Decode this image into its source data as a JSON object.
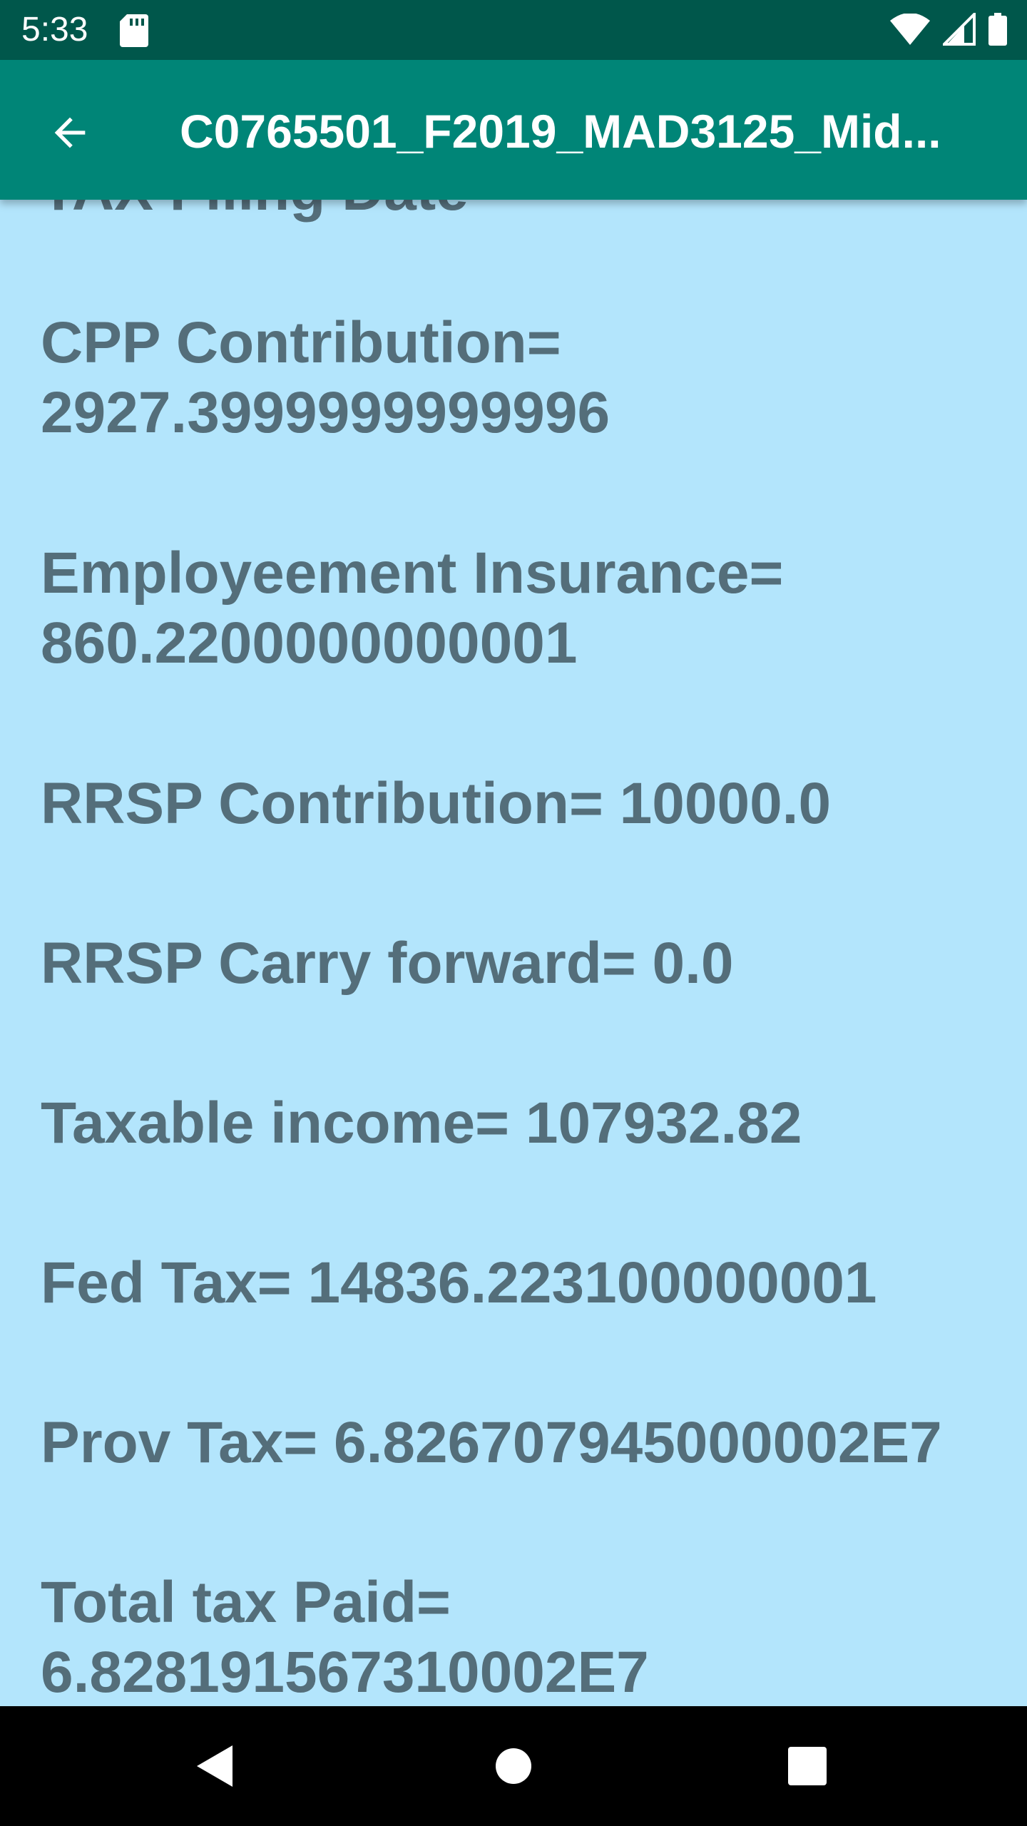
{
  "status_bar": {
    "time": "5:33",
    "icons": [
      "sd-card-icon",
      "wifi-icon",
      "signal-icon",
      "battery-icon"
    ]
  },
  "app_bar": {
    "title": "C0765501_F2019_MAD3125_Mid...",
    "back_icon": "arrow-back-icon"
  },
  "details": {
    "partial_label": "TAX Filing Date",
    "cpp_label": "CPP Contribution=",
    "cpp_value": "2927.3999999999996",
    "ei_label": "Employeement Insurance=",
    "ei_value": "860.2200000000001",
    "rrsp_label": "RRSP Contribution=",
    "rrsp_value": "10000.0",
    "rrsp_cf_label": "RRSP Carry forward=",
    "rrsp_cf_value": "0.0",
    "taxable_label": "Taxable income=",
    "taxable_value": "107932.82",
    "fed_label": "Fed Tax=",
    "fed_value": "14836.223100000001",
    "prov_label": "Prov Tax=",
    "prov_value": "6.826707945000002E7",
    "total_label": "Total tax Paid=",
    "total_value": "6.828191567310002E7"
  },
  "colors": {
    "status_bar": "#00574b",
    "app_bar": "#008577",
    "background": "#b3e5fc",
    "text": "#546e7a"
  }
}
